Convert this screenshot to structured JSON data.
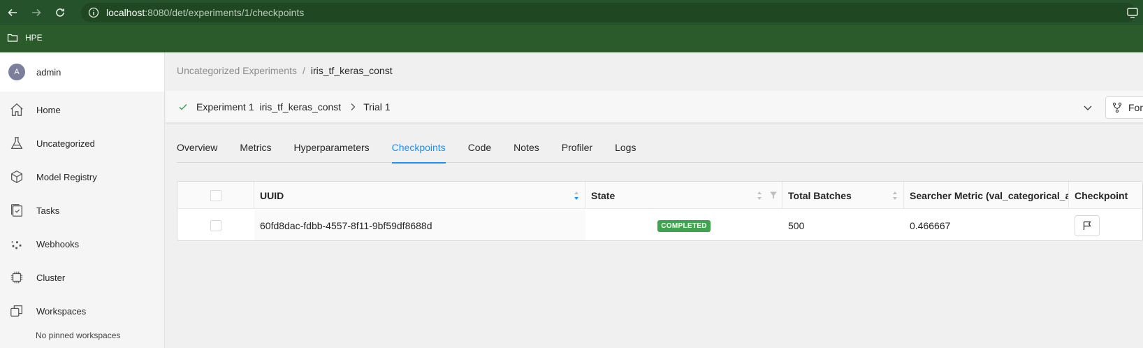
{
  "browser": {
    "url_host": "localhost",
    "url_rest": ":8080/det/experiments/1/checkpoints",
    "bookmark_label": "HPE"
  },
  "sidebar": {
    "user": {
      "avatar_letter": "A",
      "name": "admin"
    },
    "items": [
      {
        "label": "Home",
        "icon": "home-icon"
      },
      {
        "label": "Uncategorized",
        "icon": "flask-icon"
      },
      {
        "label": "Model Registry",
        "icon": "cube-icon"
      },
      {
        "label": "Tasks",
        "icon": "tasks-icon"
      },
      {
        "label": "Webhooks",
        "icon": "webhooks-icon"
      },
      {
        "label": "Cluster",
        "icon": "chip-icon"
      },
      {
        "label": "Workspaces",
        "icon": "workspaces-icon"
      }
    ],
    "pinned_empty": "No pinned workspaces"
  },
  "breadcrumb": {
    "parent": "Uncategorized Experiments",
    "separator": "/",
    "current": "iris_tf_keras_const"
  },
  "trial_header": {
    "experiment": "Experiment 1",
    "experiment_name": "iris_tf_keras_const",
    "trial": "Trial 1",
    "fork_label": "For"
  },
  "tabs": [
    {
      "label": "Overview",
      "active": false
    },
    {
      "label": "Metrics",
      "active": false
    },
    {
      "label": "Hyperparameters",
      "active": false
    },
    {
      "label": "Checkpoints",
      "active": true
    },
    {
      "label": "Code",
      "active": false
    },
    {
      "label": "Notes",
      "active": false
    },
    {
      "label": "Profiler",
      "active": false
    },
    {
      "label": "Logs",
      "active": false
    }
  ],
  "table": {
    "columns": [
      "UUID",
      "State",
      "Total Batches",
      "Searcher Metric (val_categorical_a",
      "Checkpoint"
    ],
    "rows": [
      {
        "uuid": "60fd8dac-fdbb-4557-8f11-9bf59df8688d",
        "state": "COMPLETED",
        "total_batches": "500",
        "searcher_metric": "0.466667"
      }
    ]
  },
  "colors": {
    "accent": "#1890ff",
    "success": "#3ea44d",
    "browser_bar": "#2b5b2b"
  }
}
